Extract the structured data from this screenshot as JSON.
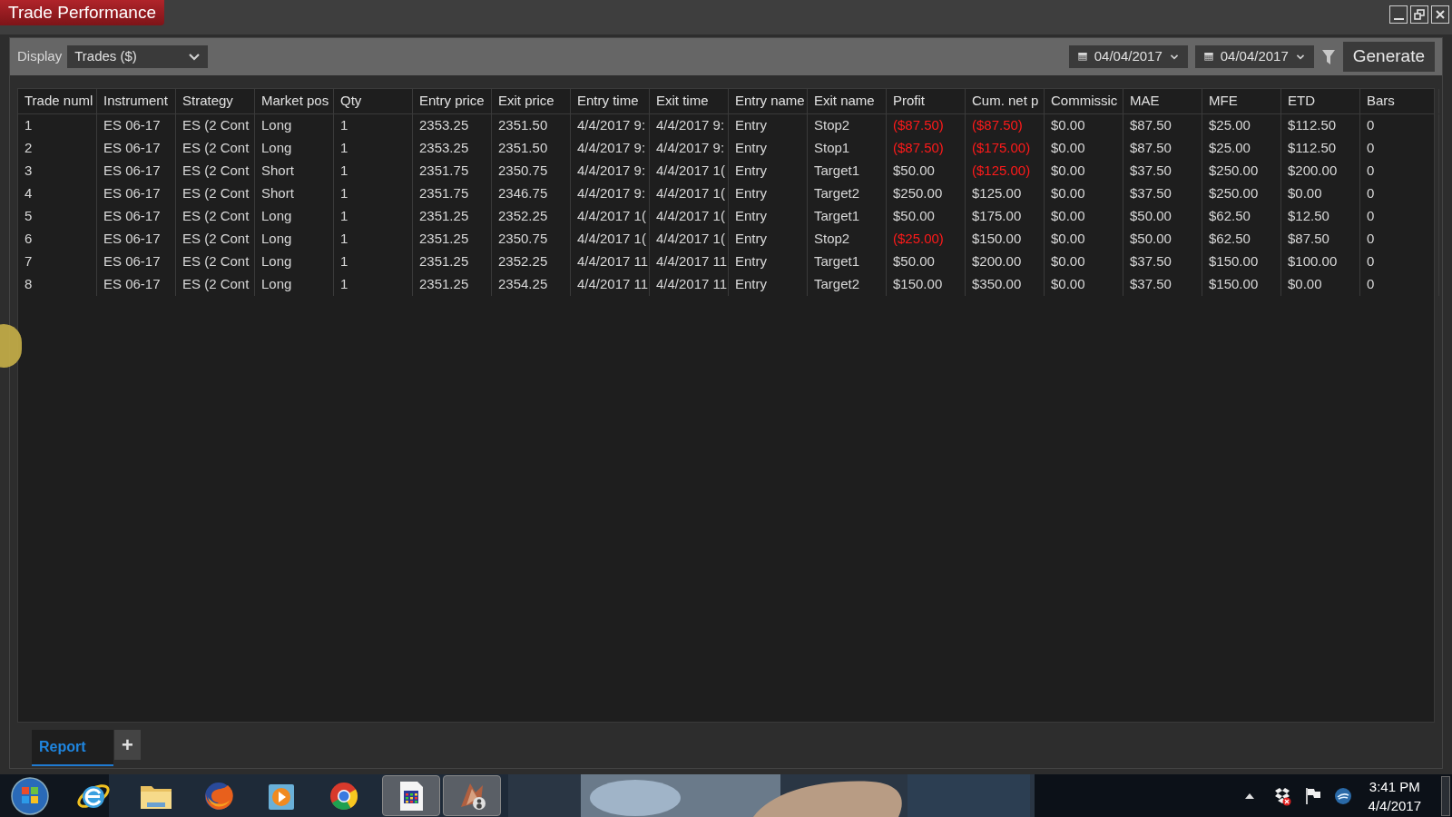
{
  "window": {
    "title": "Trade Performance"
  },
  "toolbar": {
    "display_label": "Display",
    "display_value": "Trades ($)",
    "from_date": "04/04/2017",
    "to_date": "04/04/2017",
    "generate": "Generate"
  },
  "table": {
    "columns": [
      "Trade numl",
      "Instrument",
      "Strategy",
      "Market pos",
      "Qty",
      "Entry price",
      "Exit price",
      "Entry time",
      "Exit time",
      "Entry name",
      "Exit name",
      "Profit",
      "Cum. net p",
      "Commissic",
      "MAE",
      "MFE",
      "ETD",
      "Bars"
    ],
    "rows": [
      {
        "cells": [
          "1",
          "ES 06-17",
          "ES (2 Cont",
          "Long",
          "1",
          "2353.25",
          "2351.50",
          "4/4/2017 9:",
          "4/4/2017 9:",
          "Entry",
          "Stop2",
          "($87.50)",
          "($87.50)",
          "$0.00",
          "$87.50",
          "$25.00",
          "$112.50",
          "0"
        ],
        "profit_loss": true,
        "cum_loss": true
      },
      {
        "cells": [
          "2",
          "ES 06-17",
          "ES (2 Cont",
          "Long",
          "1",
          "2353.25",
          "2351.50",
          "4/4/2017 9:",
          "4/4/2017 9:",
          "Entry",
          "Stop1",
          "($87.50)",
          "($175.00)",
          "$0.00",
          "$87.50",
          "$25.00",
          "$112.50",
          "0"
        ],
        "profit_loss": true,
        "cum_loss": true
      },
      {
        "cells": [
          "3",
          "ES 06-17",
          "ES (2 Cont",
          "Short",
          "1",
          "2351.75",
          "2350.75",
          "4/4/2017 9:",
          "4/4/2017 1(",
          "Entry",
          "Target1",
          "$50.00",
          "($125.00)",
          "$0.00",
          "$37.50",
          "$250.00",
          "$200.00",
          "0"
        ],
        "profit_loss": false,
        "cum_loss": true
      },
      {
        "cells": [
          "4",
          "ES 06-17",
          "ES (2 Cont",
          "Short",
          "1",
          "2351.75",
          "2346.75",
          "4/4/2017 9:",
          "4/4/2017 1(",
          "Entry",
          "Target2",
          "$250.00",
          "$125.00",
          "$0.00",
          "$37.50",
          "$250.00",
          "$0.00",
          "0"
        ],
        "profit_loss": false,
        "cum_loss": false
      },
      {
        "cells": [
          "5",
          "ES 06-17",
          "ES (2 Cont",
          "Long",
          "1",
          "2351.25",
          "2352.25",
          "4/4/2017 1(",
          "4/4/2017 1(",
          "Entry",
          "Target1",
          "$50.00",
          "$175.00",
          "$0.00",
          "$50.00",
          "$62.50",
          "$12.50",
          "0"
        ],
        "profit_loss": false,
        "cum_loss": false
      },
      {
        "cells": [
          "6",
          "ES 06-17",
          "ES (2 Cont",
          "Long",
          "1",
          "2351.25",
          "2350.75",
          "4/4/2017 1(",
          "4/4/2017 1(",
          "Entry",
          "Stop2",
          "($25.00)",
          "$150.00",
          "$0.00",
          "$50.00",
          "$62.50",
          "$87.50",
          "0"
        ],
        "profit_loss": true,
        "cum_loss": false
      },
      {
        "cells": [
          "7",
          "ES 06-17",
          "ES (2 Cont",
          "Long",
          "1",
          "2351.25",
          "2352.25",
          "4/4/2017 11",
          "4/4/2017 11",
          "Entry",
          "Target1",
          "$50.00",
          "$200.00",
          "$0.00",
          "$37.50",
          "$150.00",
          "$100.00",
          "0"
        ],
        "profit_loss": false,
        "cum_loss": false
      },
      {
        "cells": [
          "8",
          "ES 06-17",
          "ES (2 Cont",
          "Long",
          "1",
          "2351.25",
          "2354.25",
          "4/4/2017 11",
          "4/4/2017 11",
          "Entry",
          "Target2",
          "$150.00",
          "$350.00",
          "$0.00",
          "$37.50",
          "$150.00",
          "$0.00",
          "0"
        ],
        "profit_loss": false,
        "cum_loss": false
      }
    ]
  },
  "tabs": [
    {
      "label": "Report",
      "selected": true
    },
    {
      "label": "+",
      "selected": false
    }
  ],
  "taskbar": {
    "apps": [
      {
        "kind": "ie"
      },
      {
        "kind": "folder"
      },
      {
        "kind": "firefox"
      },
      {
        "kind": "media"
      },
      {
        "kind": "chrome"
      },
      {
        "kind": "document",
        "open": true
      },
      {
        "kind": "trader",
        "open": true
      }
    ],
    "clock_time": "3:41 PM",
    "clock_date": "4/4/2017"
  }
}
